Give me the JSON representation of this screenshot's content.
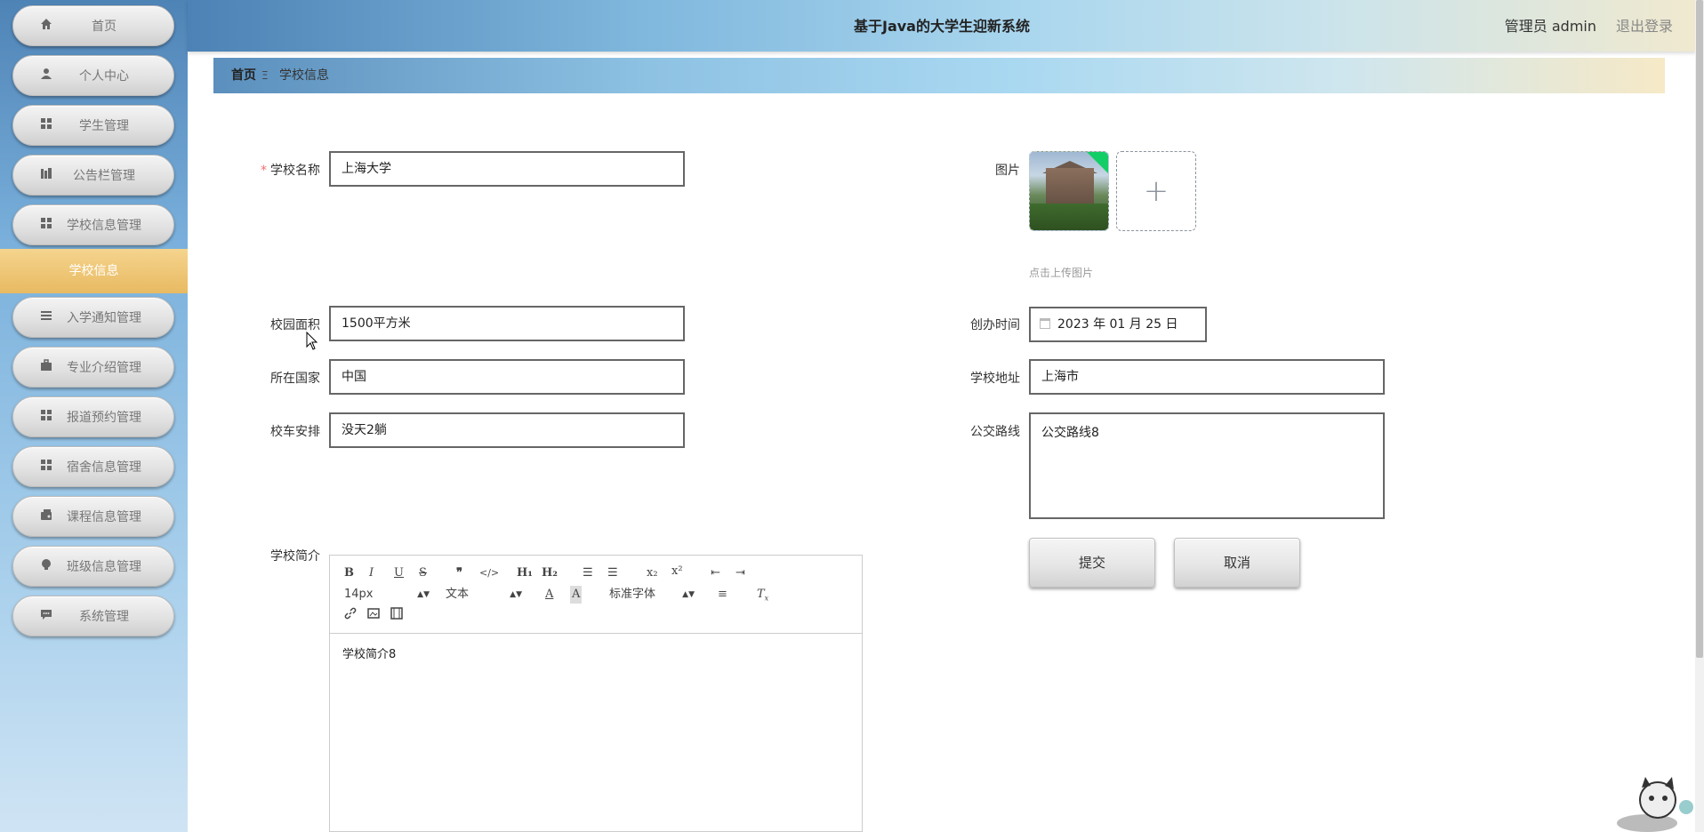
{
  "header": {
    "title": "基于Java的大学生迎新系统",
    "user": "管理员 admin",
    "logout": "退出登录"
  },
  "sidebar": {
    "items": [
      {
        "label": "首页",
        "icon": "home-icon"
      },
      {
        "label": "个人中心",
        "icon": "user-icon"
      },
      {
        "label": "学生管理",
        "icon": "grid-icon"
      },
      {
        "label": "公告栏管理",
        "icon": "chart-icon"
      },
      {
        "label": "学校信息管理",
        "icon": "grid-icon"
      },
      {
        "label": "学校信息",
        "active_sub": true
      },
      {
        "label": "入学通知管理",
        "icon": "list-icon"
      },
      {
        "label": "专业介绍管理",
        "icon": "briefcase-icon"
      },
      {
        "label": "报道预约管理",
        "icon": "grid-icon"
      },
      {
        "label": "宿舍信息管理",
        "icon": "grid-icon"
      },
      {
        "label": "课程信息管理",
        "icon": "wallet-icon"
      },
      {
        "label": "班级信息管理",
        "icon": "bulb-icon"
      },
      {
        "label": "系统管理",
        "icon": "chat-icon"
      }
    ]
  },
  "breadcrumb": {
    "home": "首页",
    "separator": "Ξ",
    "current": "学校信息"
  },
  "form": {
    "school_name": {
      "label": "学校名称",
      "value": "上海大学",
      "required_mark": "*"
    },
    "picture": {
      "label": "图片",
      "tip": "点击上传图片",
      "add_symbol": "+"
    },
    "campus_area": {
      "label": "校园面积",
      "value": "1500平方米"
    },
    "founded": {
      "label": "创办时间",
      "value": "2023 年 01 月 25 日"
    },
    "country": {
      "label": "所在国家",
      "value": "中国"
    },
    "address": {
      "label": "学校地址",
      "value": "上海市"
    },
    "shuttle": {
      "label": "校车安排",
      "value": "没天2躺"
    },
    "bus_route": {
      "label": "公交路线",
      "value": "公交路线8"
    },
    "intro": {
      "label": "学校简介",
      "value": "学校简介8"
    }
  },
  "editor": {
    "font_size": "14px",
    "block_type": "文本",
    "font_family": "标准字体"
  },
  "buttons": {
    "submit": "提交",
    "cancel": "取消"
  },
  "colors": {
    "required": "#f56c6c",
    "upload_success": "#13ce66",
    "submenu_active": "#e8ba62"
  }
}
